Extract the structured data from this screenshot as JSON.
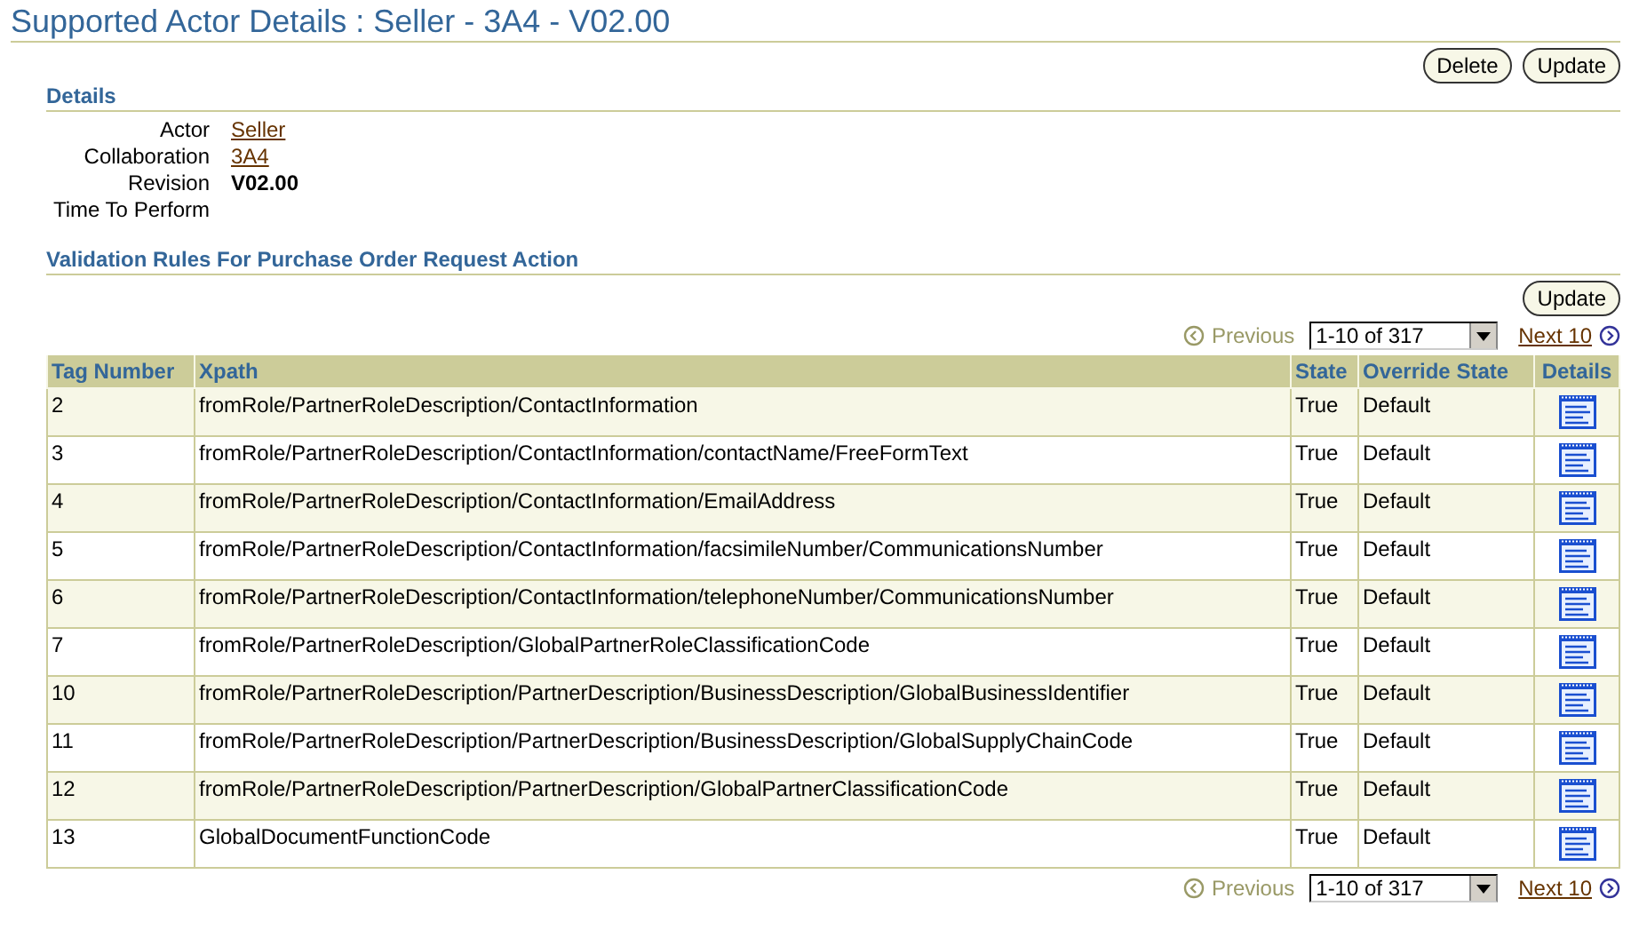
{
  "title": "Supported Actor Details : Seller - 3A4 - V02.00",
  "top_buttons": [
    "Delete",
    "Update"
  ],
  "details": {
    "heading": "Details",
    "fields": [
      {
        "label": "Actor",
        "value": "Seller",
        "kind": "link"
      },
      {
        "label": "Collaboration",
        "value": "3A4",
        "kind": "link"
      },
      {
        "label": "Revision",
        "value": "V02.00",
        "kind": "bold"
      },
      {
        "label": "Time To Perform",
        "kind": "empty"
      }
    ]
  },
  "rules": {
    "heading": "Validation Rules For Purchase Order Request Action",
    "button": "Update",
    "pagers": [
      {
        "previous": {
          "label": "Previous",
          "disabled": true
        },
        "range": "1-10 of 317",
        "next": {
          "label": "Next 10",
          "disabled": false
        }
      },
      {
        "previous": {
          "label": "Previous",
          "disabled": true
        },
        "range": "1-10 of 317",
        "next": {
          "label": "Next 10",
          "disabled": false
        }
      }
    ],
    "columns": [
      "Tag Number",
      "Xpath",
      "State",
      "Override State",
      "Details"
    ],
    "rows": [
      {
        "tag": "2",
        "xpath": "fromRole/PartnerRoleDescription/ContactInformation",
        "state": "True",
        "override": "Default"
      },
      {
        "tag": "3",
        "xpath": "fromRole/PartnerRoleDescription/ContactInformation/contactName/FreeFormText",
        "state": "True",
        "override": "Default"
      },
      {
        "tag": "4",
        "xpath": "fromRole/PartnerRoleDescription/ContactInformation/EmailAddress",
        "state": "True",
        "override": "Default"
      },
      {
        "tag": "5",
        "xpath": "fromRole/PartnerRoleDescription/ContactInformation/facsimileNumber/CommunicationsNumber",
        "state": "True",
        "override": "Default"
      },
      {
        "tag": "6",
        "xpath": "fromRole/PartnerRoleDescription/ContactInformation/telephoneNumber/CommunicationsNumber",
        "state": "True",
        "override": "Default"
      },
      {
        "tag": "7",
        "xpath": "fromRole/PartnerRoleDescription/GlobalPartnerRoleClassificationCode",
        "state": "True",
        "override": "Default"
      },
      {
        "tag": "10",
        "xpath": "fromRole/PartnerRoleDescription/PartnerDescription/BusinessDescription/GlobalBusinessIdentifier",
        "state": "True",
        "override": "Default"
      },
      {
        "tag": "11",
        "xpath": "fromRole/PartnerRoleDescription/PartnerDescription/BusinessDescription/GlobalSupplyChainCode",
        "state": "True",
        "override": "Default"
      },
      {
        "tag": "12",
        "xpath": "fromRole/PartnerRoleDescription/PartnerDescription/GlobalPartnerClassificationCode",
        "state": "True",
        "override": "Default"
      },
      {
        "tag": "13",
        "xpath": "GlobalDocumentFunctionCode",
        "state": "True",
        "override": "Default"
      }
    ]
  }
}
